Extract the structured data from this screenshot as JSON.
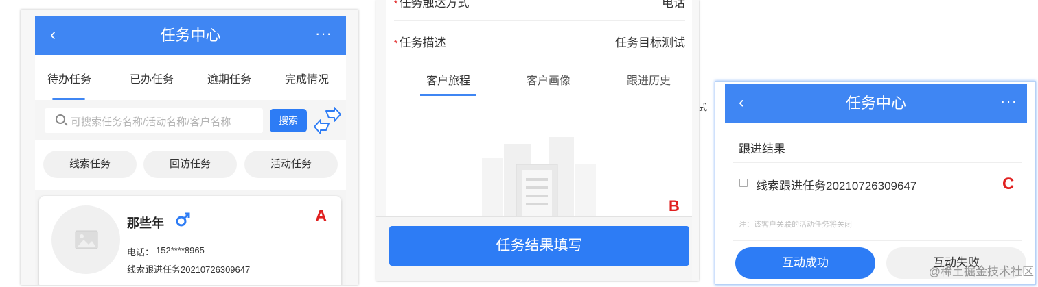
{
  "panel_a": {
    "nav": {
      "back": "‹",
      "title": "任务中心",
      "more": "···"
    },
    "tabs": [
      "待办任务",
      "已办任务",
      "逾期任务",
      "完成情况"
    ],
    "search": {
      "placeholder": "可搜索任务名称/活动名称/客户名称",
      "button": "搜索"
    },
    "chips": [
      "线索任务",
      "回访任务",
      "活动任务"
    ],
    "card": {
      "name": "那些年",
      "phone_label": "电话：",
      "phone": "152****8965",
      "task": "线索跟进任务20210726309647"
    },
    "marker": "A"
  },
  "panel_b": {
    "rows": [
      {
        "label": "任务触达方式",
        "value": "电话"
      },
      {
        "label": "任务描述",
        "value": "任务目标测试"
      }
    ],
    "tabs": [
      "客户旅程",
      "客户画像",
      "跟进历史"
    ],
    "submit": "任务结果填写",
    "marker": "B"
  },
  "stray_text": "式",
  "panel_c": {
    "nav": {
      "back": "‹",
      "title": "任务中心",
      "more": "···"
    },
    "section_title": "跟进结果",
    "checkbox_label": "线索跟进任务20210726309647",
    "note": "注：该客户关联的活动任务将关闭",
    "success_button": "互动成功",
    "fail_button": "互动失败",
    "marker": "C"
  },
  "watermark": "@稀土掘金技术社区",
  "colors": {
    "primary": "#2d7cf5",
    "nav": "#3f86f3",
    "marker": "#e02020"
  }
}
